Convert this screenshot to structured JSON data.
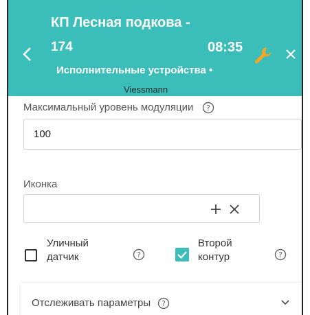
{
  "header": {
    "title_line1": "КП Лесная подкова  -",
    "title_line2": "174",
    "time": "08:35",
    "subtitle": "Исполнительные устройства •",
    "brand": "Viessmann"
  },
  "form": {
    "modulation": {
      "label": "Максимальный уровень модуляции",
      "value": "100"
    },
    "icon": {
      "label": "Иконка",
      "value": ""
    },
    "checkbox_street": {
      "label_line1": "Уличный",
      "label_line2": "датчик",
      "checked": false
    },
    "checkbox_second": {
      "label_line1": "Второй",
      "label_line2": "контур",
      "checked": true
    },
    "track_params": {
      "label": "Отслеживать параметры"
    }
  },
  "colors": {
    "accent": "#3bbdb9",
    "wrench": "#f5a623"
  },
  "icons": [
    "back-arrow-icon",
    "wrench-icon",
    "close-icon",
    "help-icon",
    "plus-icon",
    "clear-icon",
    "check-icon",
    "chevron-down-icon"
  ]
}
